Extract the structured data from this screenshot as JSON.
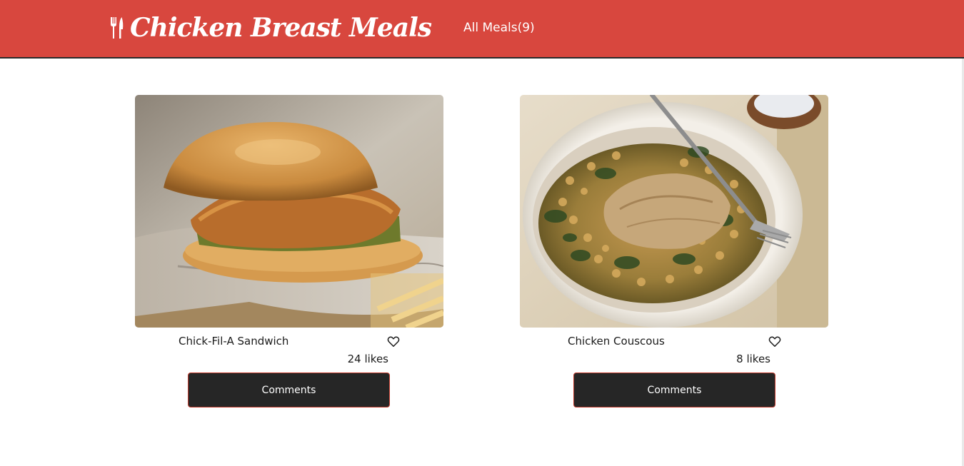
{
  "header": {
    "logo_icon": "fork-knife-icon",
    "logo_text": "Chicken Breast Meals",
    "nav_label": "All Meals",
    "nav_count": "(9)",
    "brand_color": "#d8473e"
  },
  "meals": [
    {
      "name": "Chick-Fil-A Sandwich",
      "likes": "24 likes",
      "like_icon": "heart-outline-icon",
      "image": "chicken sandwich photo",
      "comments_label": "Comments"
    },
    {
      "name": "Chicken Couscous",
      "likes": "8 likes",
      "like_icon": "heart-outline-icon",
      "image": "chicken couscous plate photo",
      "comments_label": "Comments"
    }
  ]
}
